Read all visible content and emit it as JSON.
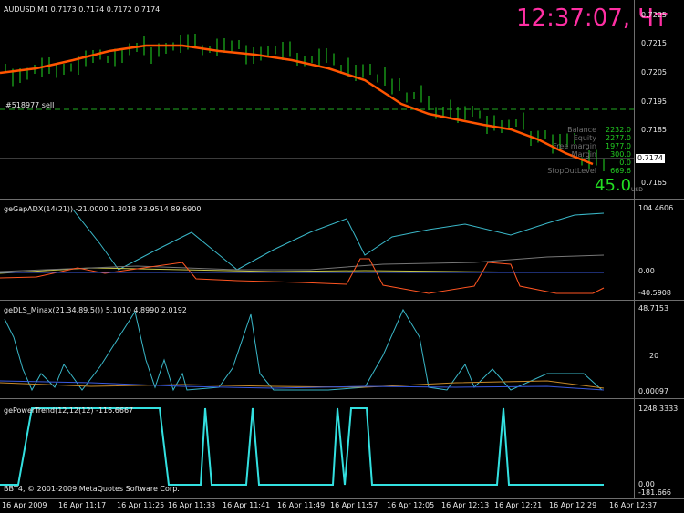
{
  "clock": "12:37:07, Чт",
  "main": {
    "title": "AUDUSD,M1  0.7173 0.7174 0.7172 0.7174",
    "order_label": "#518977 sell",
    "price_ticks": [
      "0.7225",
      "0.7215",
      "0.7205",
      "0.7195",
      "0.7185",
      "0.7165"
    ],
    "current_price": "0.7174",
    "account": [
      {
        "label": "Balance",
        "value": "2232.0"
      },
      {
        "label": "Equity",
        "value": "2277.0"
      },
      {
        "label": "Free margin",
        "value": "1977.0"
      },
      {
        "label": "Margin",
        "value": "300.0"
      },
      {
        "label": "",
        "value": "0.0"
      },
      {
        "label": "StopOutLevel",
        "value": "669.6"
      }
    ],
    "profit": "45.0",
    "currency": "USD"
  },
  "ind1": {
    "title": "geGapADX(14(21)) -21.0000 1.3018 23.9514 89.6900",
    "ticks": [
      "104.4606",
      "0.00",
      "-40.5908"
    ]
  },
  "ind2": {
    "title": "geDLS_Minax(21,34,89,5()) 5.1010 4.8990 2.0192",
    "ticks": [
      "48.7153",
      "20",
      "0.00097"
    ]
  },
  "ind3": {
    "title": "gePowerTrend(12,12(12) -116.6667",
    "ticks": [
      "1248.3333",
      "0.00",
      "-181.666"
    ]
  },
  "copyright": "BBT4, © 2001-2009 MetaQuotes Software Corp.",
  "x_ticks": [
    "16 Apr 2009",
    "16 Apr 11:17",
    "16 Apr 11:25",
    "16 Apr 11:33",
    "16 Apr 11:41",
    "16 Apr 11:49",
    "16 Apr 11:57",
    "16 Apr 12:05",
    "16 Apr 12:13",
    "16 Apr 12:21",
    "16 Apr 12:29",
    "16 Apr 12:37"
  ],
  "colors": {
    "candles": "#22dd22",
    "ma": "#ff5500",
    "clock": "#ff2fa3",
    "adx": "#3ab8c9",
    "cyan": "#33e0e0"
  }
}
